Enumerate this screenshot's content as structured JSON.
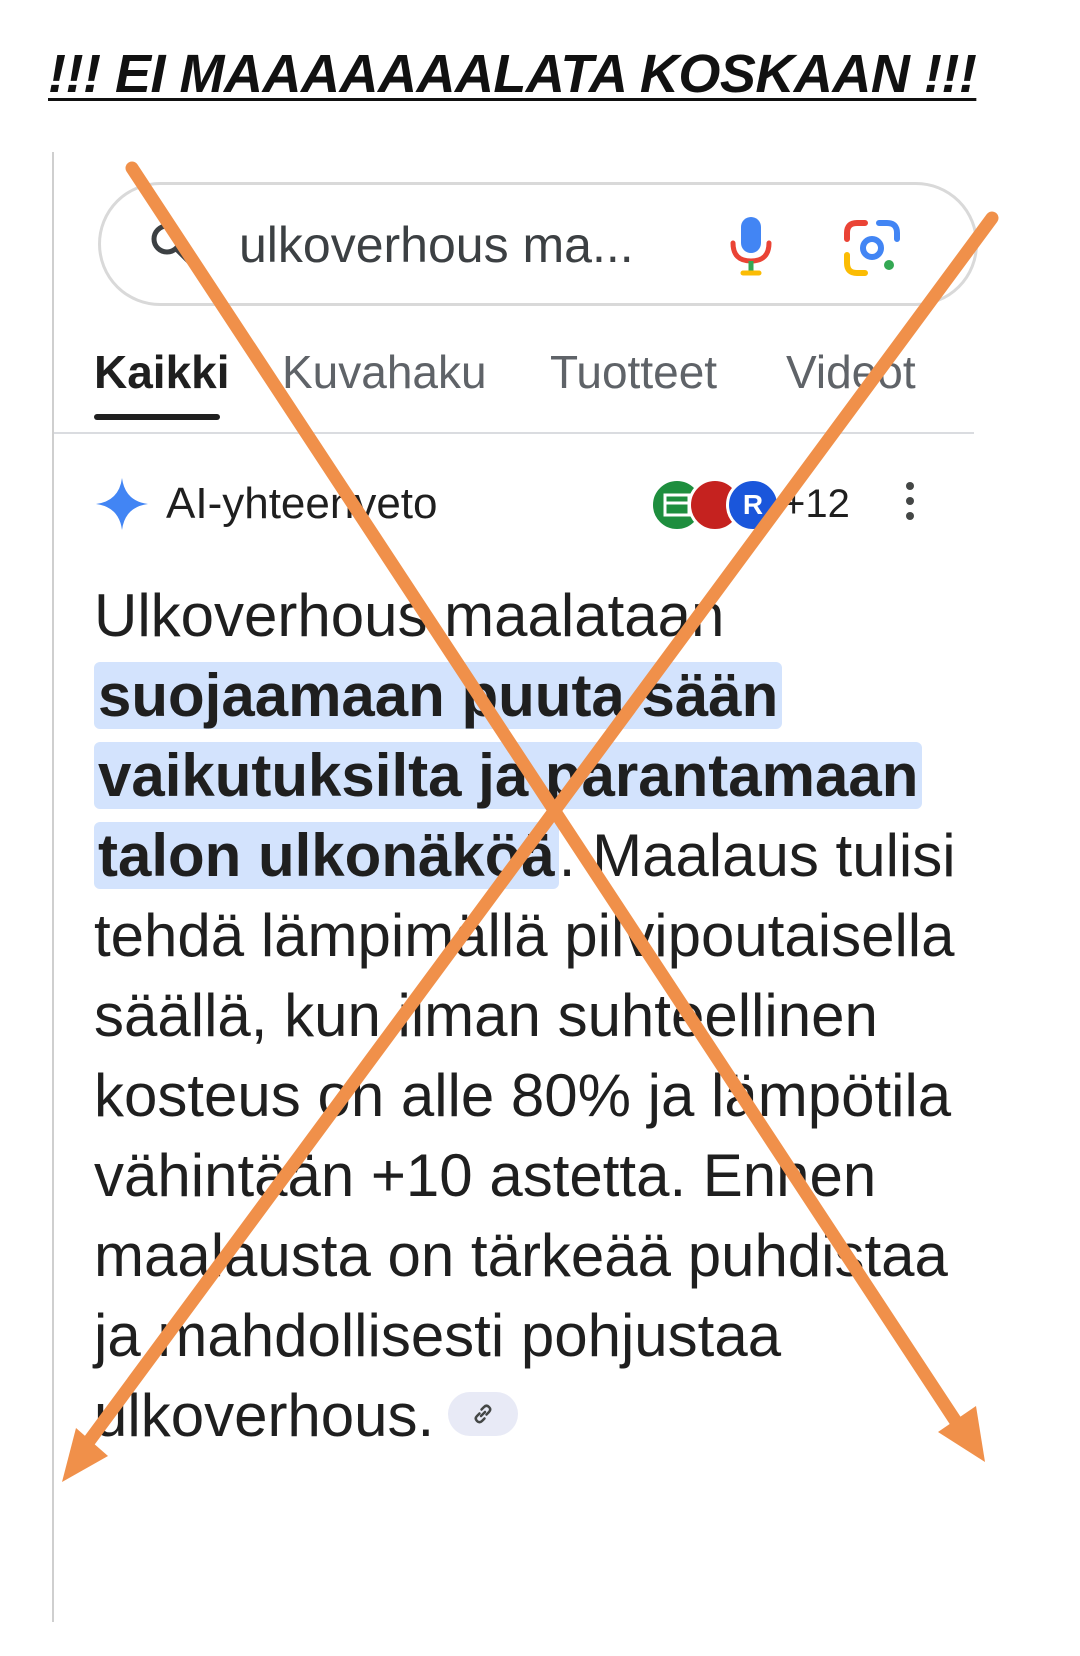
{
  "headline": "!!! EI MAAAAAAALATA KOSKAAN !!!",
  "search": {
    "query": "ulkoverhous ma..."
  },
  "tabs": [
    {
      "label": "Kaikki",
      "active": true
    },
    {
      "label": "Kuvahaku",
      "active": false
    },
    {
      "label": "Tuotteet",
      "active": false
    },
    {
      "label": "Videot",
      "active": false
    }
  ],
  "ai_overview": {
    "label": "AI-yhteenveto",
    "sources_count": "+12",
    "source_badge_letter": "R",
    "text_before": "Ulkoverhous maalataan ",
    "highlight": "suojaamaan puuta sään vaikutuksilta ja parantamaan talon ulkonäköä",
    "text_after": ". Maalaus tulisi tehdä lämpimällä pilvipoutaisella säällä, kun ilman suhteellinen kosteus on alle 80% ja lämpötila vähintään +10 astetta. Ennen maalausta on tärkeää puhdistaa ja mahdollisesti pohjustaa ulkoverhous."
  },
  "colors": {
    "cross": "#f0904a",
    "highlight": "#d3e3fd",
    "sparkle": "#4285f4"
  }
}
